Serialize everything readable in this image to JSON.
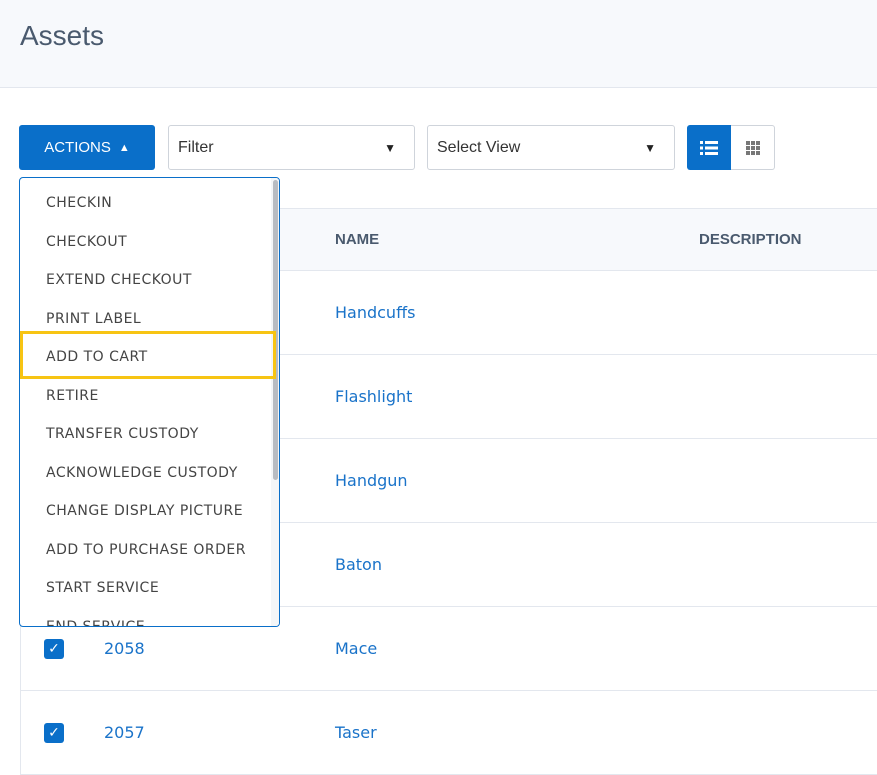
{
  "header": {
    "title": "Assets"
  },
  "toolbar": {
    "actions_label": "ACTIONS",
    "filter_value": "Filter",
    "view_value": "Select View"
  },
  "table": {
    "columns": [
      "NAME",
      "DESCRIPTION"
    ],
    "rows": [
      {
        "id": "",
        "name": "Handcuffs"
      },
      {
        "id": "",
        "name": "Flashlight"
      },
      {
        "id": "",
        "name": "Handgun"
      },
      {
        "id": "",
        "name": "Baton"
      },
      {
        "id": "2058",
        "name": "Mace",
        "checked": true
      },
      {
        "id": "2057",
        "name": "Taser",
        "checked": true
      }
    ]
  },
  "menu": {
    "items": [
      "CHECKIN",
      "CHECKOUT",
      "EXTEND CHECKOUT",
      "PRINT LABEL",
      "ADD TO CART",
      "RETIRE",
      "TRANSFER CUSTODY",
      "ACKNOWLEDGE CUSTODY",
      "CHANGE DISPLAY PICTURE",
      "ADD TO PURCHASE ORDER",
      "START SERVICE",
      "END SERVICE"
    ],
    "highlighted": "ADD TO CART"
  },
  "colors": {
    "accent": "#0a6fc9",
    "highlight": "#f7c413",
    "link": "#1a73c9"
  }
}
